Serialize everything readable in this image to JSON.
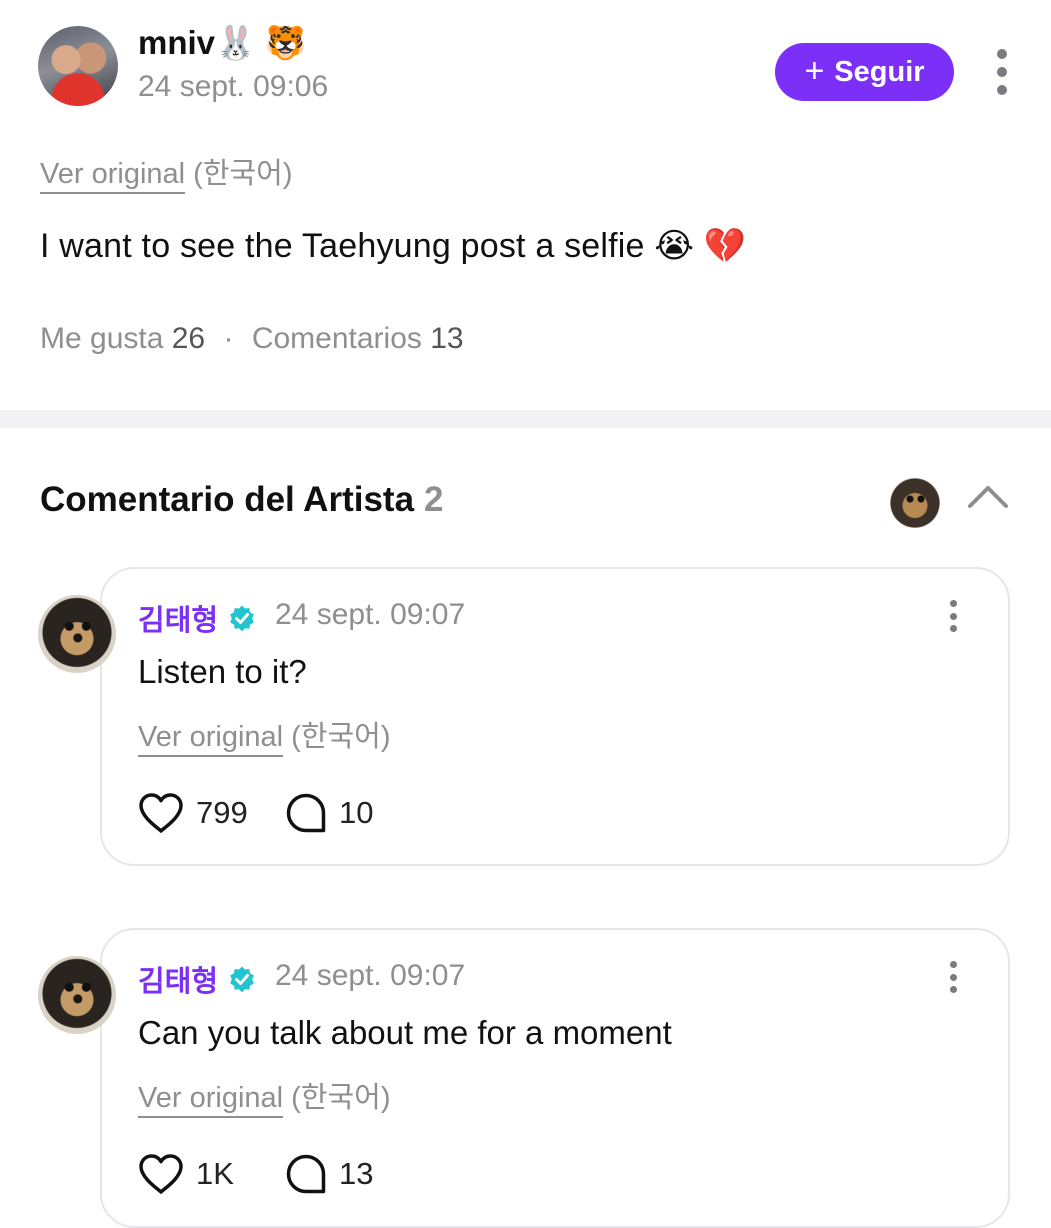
{
  "post": {
    "username": "mniv🐰 🐯",
    "date": "24 sept. 09:06",
    "follow_label": "Seguir",
    "follow_plus": "+",
    "ver_original": "Ver original",
    "language": "(한국어)",
    "body": "I want to see the Taehyung post a selfie 😭 💔",
    "likes_label": "Me gusta",
    "likes_count": "26",
    "separator": "·",
    "comments_label": "Comentarios",
    "comments_count": "13"
  },
  "artist_section": {
    "title": "Comentario del Artista",
    "count": "2",
    "comments": [
      {
        "author": "김태형",
        "date": "24 sept. 09:07",
        "text": "Listen to it?",
        "ver_original": "Ver original",
        "language": "(한국어)",
        "likes": "799",
        "replies": "10"
      },
      {
        "author": "김태형",
        "date": "24 sept. 09:07",
        "text": "Can you talk about me for a moment",
        "ver_original": "Ver original",
        "language": "(한국어)",
        "likes": "1K",
        "replies": "13"
      }
    ]
  },
  "colors": {
    "accent": "#7b2ff7",
    "verified": "#21c4cf",
    "muted_text": "#8e8e93"
  },
  "icons": [
    "plus-icon",
    "more-vertical-icon",
    "verified-icon",
    "chevron-up-icon",
    "heart-icon",
    "comment-bubble-icon"
  ]
}
